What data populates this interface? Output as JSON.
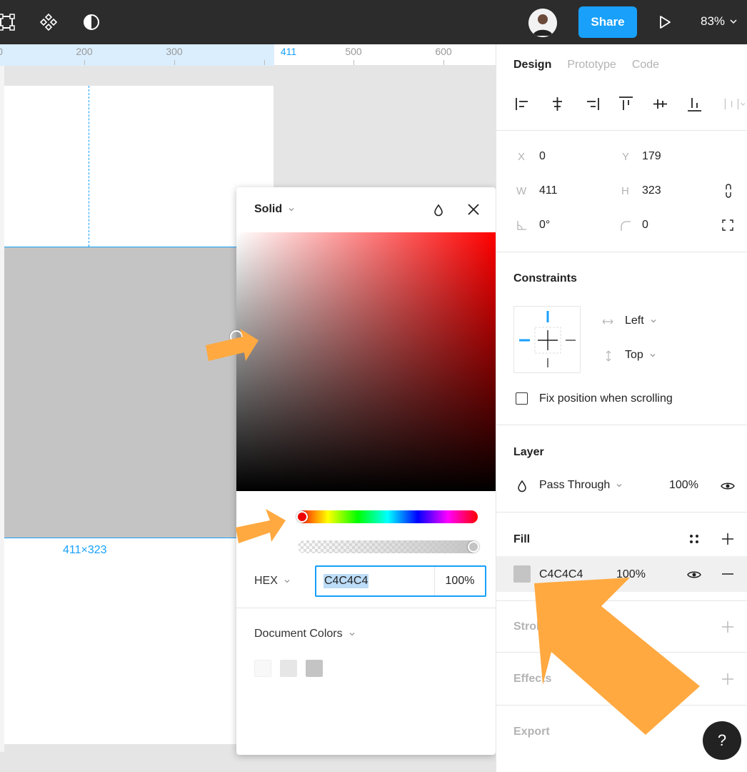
{
  "toolbar": {
    "share_label": "Share",
    "zoom_label": "83%"
  },
  "ruler": {
    "labels": [
      "0",
      "200",
      "300",
      "411",
      "500",
      "600"
    ]
  },
  "canvas": {
    "dimension_label": "411×323"
  },
  "picker": {
    "mode_label": "Solid",
    "format_label": "HEX",
    "hex_value": "C4C4C4",
    "alpha_value": "100%",
    "document_colors_label": "Document Colors",
    "swatches": [
      "#f8f8f8",
      "#e6e6e6",
      "#c4c4c4"
    ]
  },
  "panel": {
    "tabs": [
      "Design",
      "Prototype",
      "Code"
    ],
    "x_label": "X",
    "x_value": "0",
    "y_label": "Y",
    "y_value": "179",
    "w_label": "W",
    "w_value": "411",
    "h_label": "H",
    "h_value": "323",
    "rotation_value": "0°",
    "radius_value": "0",
    "constraints_title": "Constraints",
    "constraint_h": "Left",
    "constraint_v": "Top",
    "fix_position_label": "Fix position when scrolling",
    "layer_title": "Layer",
    "blend_mode": "Pass Through",
    "layer_opacity": "100%",
    "fill_title": "Fill",
    "fill_hex": "C4C4C4",
    "fill_opacity": "100%",
    "stroke_title": "Stroke",
    "effects_title": "Effects",
    "export_title": "Export",
    "help_label": "?"
  },
  "colors": {
    "accent": "#18a0fb",
    "toolbar_bg": "#2c2c2c",
    "fill_color": "#c4c4c4",
    "annotation_arrow": "#ffa940"
  }
}
